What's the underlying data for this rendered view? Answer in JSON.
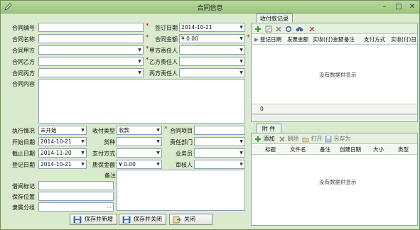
{
  "window": {
    "title": "合同信息",
    "controls": [
      "minimize-icon",
      "maximize-icon",
      "close-icon"
    ]
  },
  "left_form": {
    "rows1": [
      {
        "label": "合同编号",
        "value": ""
      },
      {
        "label": "合同名称",
        "value": ""
      },
      {
        "label": "合同甲方",
        "value": ""
      },
      {
        "label": "合同乙方",
        "value": ""
      },
      {
        "label": "合同丙方",
        "value": ""
      }
    ],
    "rows1_right": [
      {
        "label": "签订日期",
        "value": "2014-10-21"
      },
      {
        "label": "合同金额",
        "value": "¥ 0.00"
      },
      {
        "label": "甲方责任人",
        "value": ""
      },
      {
        "label": "乙方责任人",
        "value": ""
      },
      {
        "label": "丙方责任人",
        "value": ""
      }
    ],
    "content_label": "合同内容",
    "content_value": "",
    "grid": [
      [
        {
          "label": "执行情况",
          "value": "未开始"
        },
        {
          "label": "收付类型",
          "value": "收款"
        },
        {
          "label": "合同项目",
          "value": ""
        }
      ],
      [
        {
          "label": "开始日期",
          "value": "2014-10-21"
        },
        {
          "label": "货种",
          "value": ""
        },
        {
          "label": "责任部门",
          "value": ""
        }
      ],
      [
        {
          "label": "截止日期",
          "value": "2014-11-20"
        },
        {
          "label": "支付方式",
          "value": ""
        },
        {
          "label": "业务员",
          "value": ""
        }
      ],
      [
        {
          "label": "登记日期",
          "value": "2014-10-21"
        },
        {
          "label": "质保金额",
          "value": "¥ 0.00"
        },
        {
          "label": "审核人",
          "value": ""
        }
      ]
    ],
    "remarks_label": "备注",
    "remarks_value": "",
    "extra": [
      {
        "label": "借阅标记",
        "value": ""
      },
      {
        "label": "保存位置",
        "value": ""
      },
      {
        "label": "隶属分组",
        "value": ""
      }
    ],
    "ellipsis": "…"
  },
  "payments_panel": {
    "tab": "收付款记录",
    "columns": [
      "登记日期",
      "发票金额",
      "实收(付)金额",
      "备注",
      "支付方式",
      "实收(付)日"
    ],
    "empty_text": "没有数据供显示",
    "footer_value": "0"
  },
  "attachments_panel": {
    "tab": "附 件",
    "toolbar": {
      "add": "添加",
      "delete": "删除",
      "open": "打开",
      "save_as": "另存为"
    },
    "columns": [
      "标题",
      "文件名",
      "备注",
      "创建日期",
      "大小",
      "类型"
    ],
    "empty_text": "没有数据供显示"
  },
  "buttons": {
    "save_new": "保存并新增",
    "save_close": "保存并关闭",
    "close": "关闭"
  },
  "colors": {
    "accent": "#9cc67f",
    "background": "#d9ebcc",
    "required": "#dd0000"
  }
}
